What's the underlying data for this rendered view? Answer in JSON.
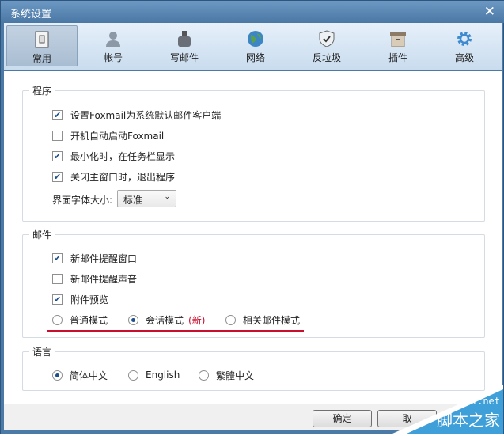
{
  "window": {
    "title": "系统设置",
    "close_label": "✕"
  },
  "tabs": [
    {
      "label": "常用",
      "icon": "switch-icon",
      "active": true
    },
    {
      "label": "帐号",
      "icon": "user-icon"
    },
    {
      "label": "写邮件",
      "icon": "ink-bottle-icon"
    },
    {
      "label": "网络",
      "icon": "globe-icon"
    },
    {
      "label": "反垃圾",
      "icon": "shield-icon"
    },
    {
      "label": "插件",
      "icon": "box-icon"
    },
    {
      "label": "高级",
      "icon": "gear-icon"
    }
  ],
  "program": {
    "title": "程序",
    "options": [
      {
        "label": "设置Foxmail为系统默认邮件客户端",
        "checked": true
      },
      {
        "label": "开机自动启动Foxmail",
        "checked": false
      },
      {
        "label": "最小化时，在任务栏显示",
        "checked": true
      },
      {
        "label": "关闭主窗口时，退出程序",
        "checked": true
      }
    ],
    "font_size_label": "界面字体大小:",
    "font_size_value": "标准"
  },
  "mail": {
    "title": "邮件",
    "options": [
      {
        "label": "新邮件提醒窗口",
        "checked": true
      },
      {
        "label": "新邮件提醒声音",
        "checked": false
      },
      {
        "label": "附件预览",
        "checked": true
      }
    ],
    "modes": [
      {
        "label": "普通模式",
        "selected": false
      },
      {
        "label": "会话模式",
        "selected": true,
        "badge": "(新)"
      },
      {
        "label": "相关邮件模式",
        "selected": false
      }
    ],
    "underline_color": "#c8102e"
  },
  "language": {
    "title": "语言",
    "options": [
      {
        "label": "简体中文",
        "selected": true
      },
      {
        "label": "English",
        "selected": false
      },
      {
        "label": "繁體中文",
        "selected": false
      }
    ]
  },
  "buttons": {
    "ok": "确定",
    "cancel": "取"
  },
  "watermark": {
    "site": "jb51.net",
    "name": "脚本之家"
  }
}
